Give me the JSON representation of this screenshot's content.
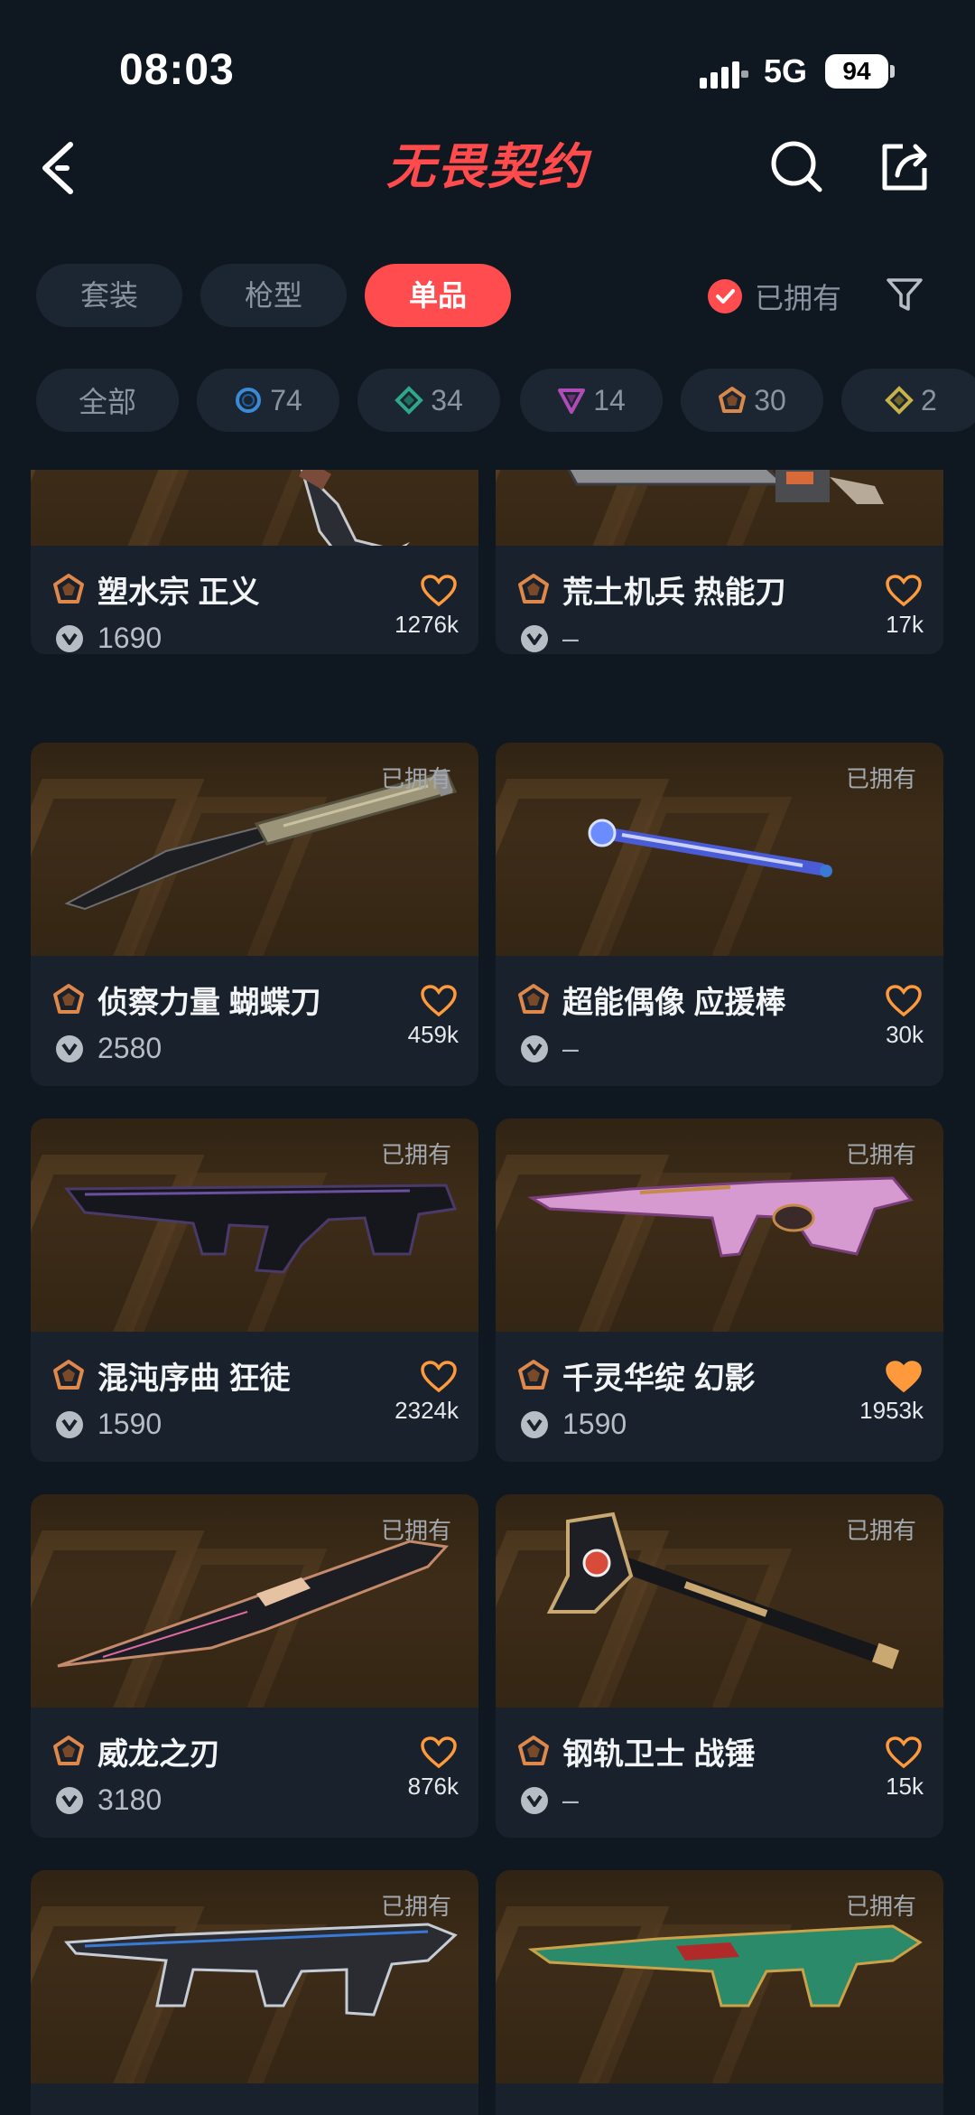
{
  "status": {
    "time": "08:03",
    "network": "5G",
    "battery": "94"
  },
  "header": {
    "title": "无畏契约"
  },
  "tabs": [
    {
      "label": "套装",
      "active": false
    },
    {
      "label": "枪型",
      "active": false
    },
    {
      "label": "单品",
      "active": true
    }
  ],
  "owned_filter": {
    "label": "已拥有",
    "checked": true
  },
  "chips": [
    {
      "label": "全部"
    },
    {
      "count": "74",
      "icon": "circle-tier-icon",
      "color": "#3a8ad6"
    },
    {
      "count": "34",
      "icon": "diamond-tier-icon",
      "color": "#2fa88a"
    },
    {
      "count": "14",
      "icon": "triangle-tier-icon",
      "color": "#b04bb8"
    },
    {
      "count": "30",
      "icon": "pentagon-tier-icon",
      "color": "#d8894a"
    },
    {
      "count": "2",
      "icon": "diamond-gold-tier-icon",
      "color": "#c9b24a"
    }
  ],
  "owned_tag": "已拥有",
  "items": [
    {
      "name": "塑水宗 正义",
      "price": "1690",
      "likes": "1276k",
      "liked": false,
      "owned": false
    },
    {
      "name": "荒土机兵 热能刀",
      "price": "–",
      "likes": "17k",
      "liked": false,
      "owned": false
    },
    {
      "name": "侦察力量 蝴蝶刀",
      "price": "2580",
      "likes": "459k",
      "liked": false,
      "owned": true
    },
    {
      "name": "超能偶像 应援棒",
      "price": "–",
      "likes": "30k",
      "liked": false,
      "owned": true
    },
    {
      "name": "混沌序曲 狂徒",
      "price": "1590",
      "likes": "2324k",
      "liked": false,
      "owned": true
    },
    {
      "name": "千灵华绽 幻影",
      "price": "1590",
      "likes": "1953k",
      "liked": true,
      "owned": true
    },
    {
      "name": "威龙之刃",
      "price": "3180",
      "likes": "876k",
      "liked": false,
      "owned": true
    },
    {
      "name": "钢轨卫士 战锤",
      "price": "–",
      "likes": "15k",
      "liked": false,
      "owned": true
    },
    {
      "name": "",
      "price": "",
      "likes": "",
      "liked": false,
      "owned": true
    },
    {
      "name": "",
      "price": "",
      "likes": "",
      "liked": false,
      "owned": true
    }
  ],
  "colors": {
    "accent": "#ff4d4f",
    "like": "#ff9a3c",
    "tier": "#e0874a"
  }
}
